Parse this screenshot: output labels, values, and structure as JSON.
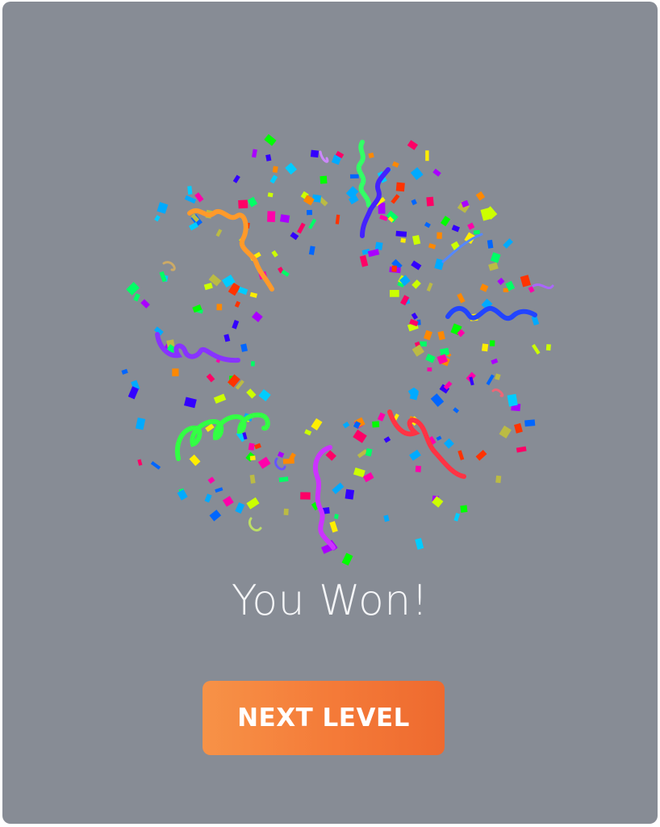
{
  "screen": {
    "title": "You Won!",
    "next_level_label": "NEXT LEVEL"
  },
  "colors": {
    "card_background": "#878c95",
    "title_text": "#f4f5f7",
    "button_gradient_start": "#f79247",
    "button_gradient_end": "#ee6a2f",
    "button_text": "#ffffff",
    "confetti_palette": [
      "#00ff66",
      "#ff00aa",
      "#00ccff",
      "#ffee00",
      "#ff3300",
      "#3300ff",
      "#aa00ff",
      "#00ff00",
      "#ff8800",
      "#00aaff",
      "#ccff00",
      "#ff0066",
      "#bbbb44",
      "#0066ff"
    ]
  },
  "icons": {
    "confetti": "confetti-burst"
  }
}
